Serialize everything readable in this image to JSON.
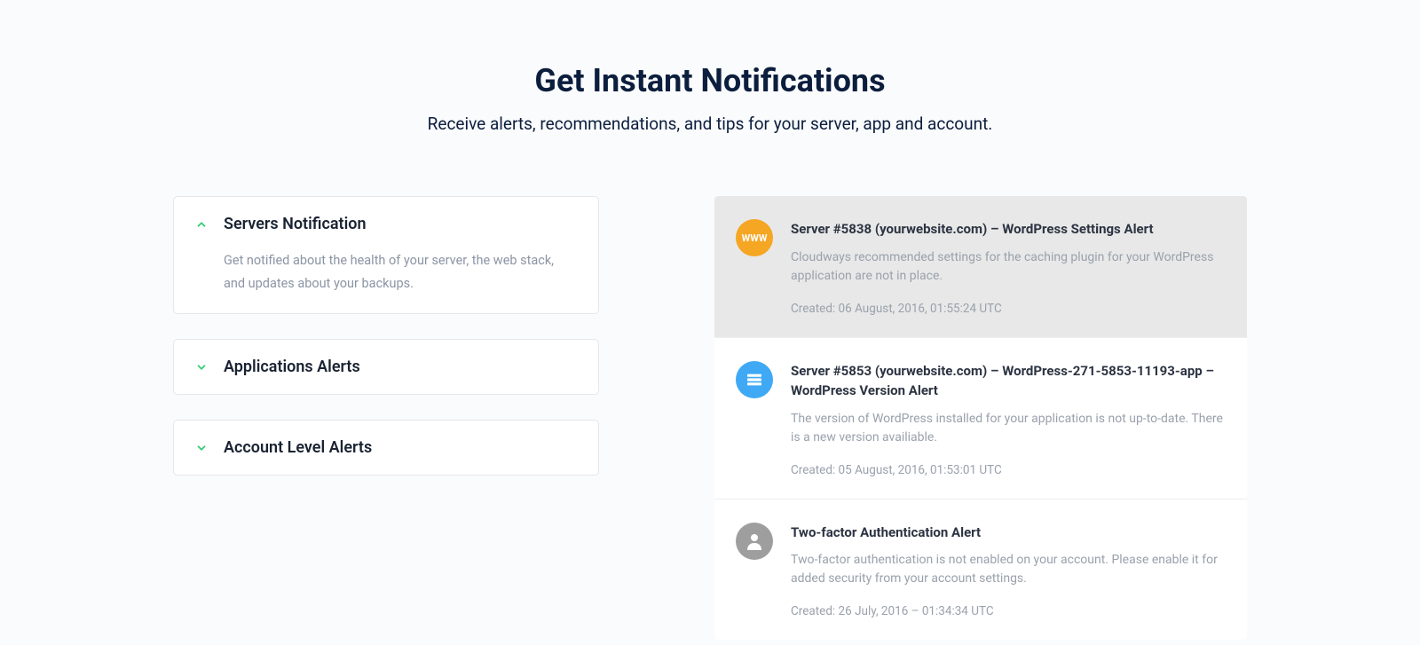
{
  "header": {
    "title": "Get Instant Notifications",
    "subtitle": "Receive alerts, recommendations, and tips for your server, app and account."
  },
  "accordion": [
    {
      "title": "Servers Notification",
      "expanded": true,
      "body": "Get notified about the health of your server, the web stack, and updates about your backups."
    },
    {
      "title": "Applications Alerts",
      "expanded": false
    },
    {
      "title": "Account Level Alerts",
      "expanded": false
    }
  ],
  "notifications": [
    {
      "icon": "www",
      "icon_color": "orange",
      "title": "Server #5838 (yourwebsite.com) – WordPress Settings Alert",
      "desc": "Cloudways recommended settings for the caching plugin for your WordPress application are not in place.",
      "date": "Created: 06 August, 2016, 01:55:24 UTC",
      "highlight": true
    },
    {
      "icon": "server",
      "icon_color": "blue",
      "title": "Server #5853 (yourwebsite.com) – WordPress-271-5853-11193-app – WordPress Version Alert",
      "desc": "The version of WordPress installed for your application is not up-to-date. There is a new version availiable.",
      "date": "Created: 05 August, 2016, 01:53:01 UTC",
      "highlight": false
    },
    {
      "icon": "person",
      "icon_color": "gray",
      "title": "Two-factor Authentication Alert",
      "desc": "Two-factor authentication is not enabled on your account. Please enable it for added security from your account settings.",
      "date": "Created: 26 July, 2016 – 01:34:34 UTC",
      "highlight": false
    }
  ]
}
